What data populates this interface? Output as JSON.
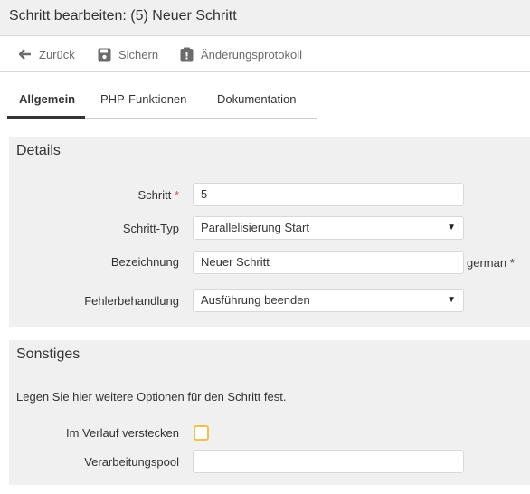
{
  "window": {
    "title": "Schritt bearbeiten: (5) Neuer Schritt"
  },
  "toolbar": {
    "back_label": "Zurück",
    "save_label": "Sichern",
    "changelog_label": "Änderungsprotokoll"
  },
  "tabs": [
    {
      "label": "Allgemein",
      "active": true
    },
    {
      "label": "PHP-Funktionen",
      "active": false
    },
    {
      "label": "Dokumentation",
      "active": false
    }
  ],
  "details": {
    "title": "Details",
    "step_label": "Schritt",
    "required_mark": "*",
    "step_value": "5",
    "type_label": "Schritt-Typ",
    "type_value": "Parallelisierung Start",
    "name_label": "Bezeichnung",
    "name_value": "Neuer Schritt",
    "name_suffix": "german *",
    "error_label": "Fehlerbehandlung",
    "error_value": "Ausführung beenden"
  },
  "other": {
    "title": "Sonstiges",
    "description": "Legen Sie hier weitere Optionen für den Schritt fest.",
    "hide_label": "Im Verlauf verstecken",
    "hide_checked": false,
    "pool_label": "Verarbeitungspool",
    "pool_value": ""
  },
  "colors": {
    "required": "#d9534f",
    "checkbox_border": "#f0c24a",
    "panel_bg": "#f0f0f0"
  }
}
